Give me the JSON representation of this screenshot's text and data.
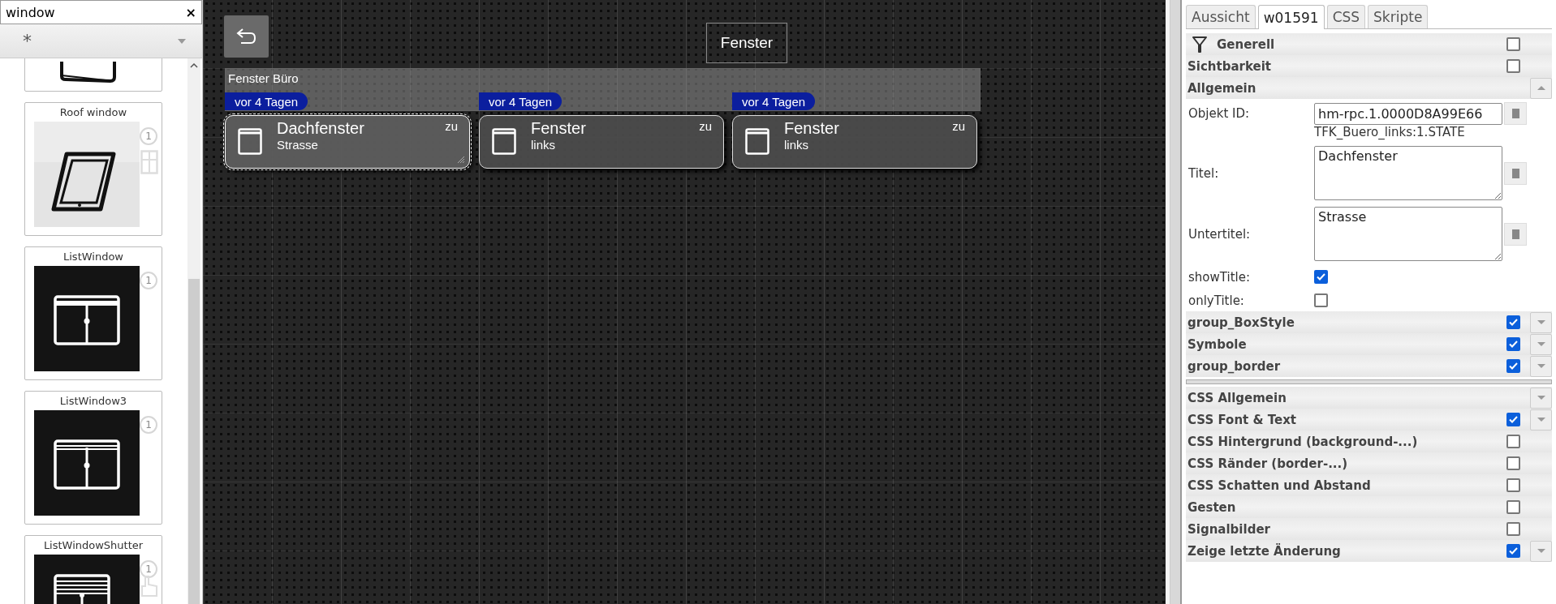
{
  "palette": {
    "search": {
      "value": "window",
      "clear": "×"
    },
    "filter": {
      "value": "*"
    },
    "widgets": [
      {
        "kind": "partial"
      },
      {
        "kind": "roof",
        "label": "Roof window",
        "count": "1"
      },
      {
        "kind": "list",
        "label": "ListWindow",
        "count": "1"
      },
      {
        "kind": "list3",
        "label": "ListWindow3",
        "count": "1"
      },
      {
        "kind": "shutter",
        "label": "ListWindowShutter",
        "count": "1"
      }
    ]
  },
  "canvas": {
    "title": "Fenster",
    "group": {
      "label": "Fenster Büro"
    },
    "tiles": [
      {
        "badge": "vor 4 Tagen",
        "title": "Dachfenster",
        "subtitle": "Strasse",
        "state": "zu",
        "selected": true
      },
      {
        "badge": "vor 4 Tagen",
        "title": "Fenster",
        "subtitle": "links",
        "state": "zu",
        "selected": false
      },
      {
        "badge": "vor 4 Tagen",
        "title": "Fenster",
        "subtitle": "links",
        "state": "zu",
        "selected": false
      }
    ]
  },
  "inspector": {
    "tabs": [
      {
        "label": "Aussicht",
        "selected": false
      },
      {
        "label": "w01591",
        "selected": true
      },
      {
        "label": "CSS",
        "selected": false
      },
      {
        "label": "Skripte",
        "selected": false
      }
    ],
    "rows": [
      {
        "kind": "group",
        "label": "Generell",
        "filter": true,
        "checked": false
      },
      {
        "kind": "group",
        "label": "Sichtbarkeit",
        "checked": false
      },
      {
        "kind": "group",
        "label": "Allgemein",
        "expanded": true
      },
      {
        "kind": "input",
        "label": "Objekt ID:",
        "value": "hm-rpc.1.0000D8A99E66",
        "hint": "TFK_Buero_links:1.STATE"
      },
      {
        "kind": "textarea",
        "label": "Titel:",
        "value": "Dachfenster"
      },
      {
        "kind": "textarea",
        "label": "Untertitel:",
        "value": "Strasse"
      },
      {
        "kind": "check",
        "label": "showTitle:",
        "checked": true
      },
      {
        "kind": "check",
        "label": "onlyTitle:",
        "checked": false
      },
      {
        "kind": "group",
        "label": "group_BoxStyle",
        "checked": true,
        "expanded": false
      },
      {
        "kind": "group",
        "label": "Symbole",
        "checked": true,
        "expanded": false
      },
      {
        "kind": "group",
        "label": "group_border",
        "checked": true,
        "expanded": false
      },
      {
        "kind": "separator"
      },
      {
        "kind": "group",
        "label": "CSS Allgemein",
        "expanded": false
      },
      {
        "kind": "group",
        "label": "CSS Font & Text",
        "checked": true,
        "expanded": false
      },
      {
        "kind": "group",
        "label": "CSS Hintergrund (background-...)",
        "checked": false
      },
      {
        "kind": "group",
        "label": "CSS Ränder (border-...)",
        "checked": false
      },
      {
        "kind": "group",
        "label": "CSS Schatten und Abstand",
        "checked": false
      },
      {
        "kind": "group",
        "label": "Gesten",
        "checked": false
      },
      {
        "kind": "group",
        "label": "Signalbilder",
        "checked": false
      },
      {
        "kind": "group",
        "label": "Zeige letzte Änderung",
        "checked": true,
        "expanded": false
      }
    ]
  }
}
